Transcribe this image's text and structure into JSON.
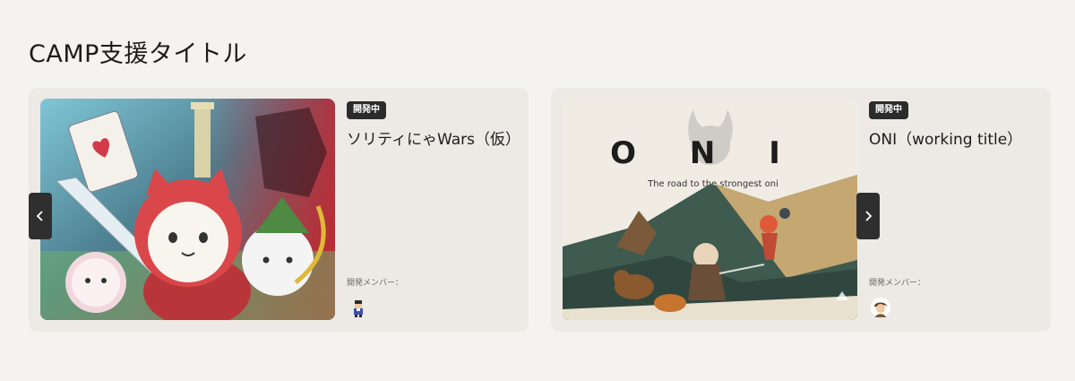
{
  "section": {
    "title": "CAMP支援タイトル"
  },
  "cards": [
    {
      "status": "開発中",
      "title": "ソリティにゃWars（仮）",
      "members_label": "開発メンバー："
    },
    {
      "status": "開発中",
      "title": "ONI（working title）",
      "members_label": "開発メンバー：",
      "art_logo": "O N I",
      "art_tagline": "The road to the strongest oni"
    }
  ],
  "nav": {
    "prev_icon": "chevron-left-icon",
    "next_icon": "chevron-right-icon"
  },
  "colors": {
    "background": "#f5f3ef",
    "card": "#edeae5",
    "badge": "#2b2b2b",
    "nav": "#2f2f2f"
  }
}
